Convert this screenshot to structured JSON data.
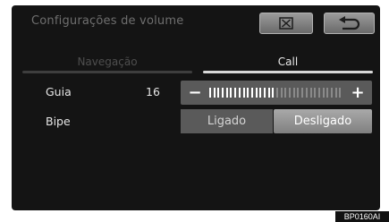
{
  "header": {
    "title": "Configurações de volume",
    "close_icon": "close-box-icon",
    "back_icon": "return-arrow-icon"
  },
  "tabs": [
    {
      "label": "Navegação",
      "active": false
    },
    {
      "label": "Call",
      "active": true
    }
  ],
  "settings": {
    "guia": {
      "label": "Guia",
      "value": "16",
      "minus_symbol": "−",
      "plus_symbol": "+",
      "level": 16,
      "max": 32
    },
    "bipe": {
      "label": "Bipe",
      "options": [
        "Ligado",
        "Desligado"
      ],
      "selected": "Desligado"
    }
  },
  "colors": {
    "background": "#141414",
    "active_tab_line": "#d8d8d8",
    "tick_on": "#ffffff",
    "tick_off": "#8a8a8a"
  },
  "image_code": "BP0160AI"
}
